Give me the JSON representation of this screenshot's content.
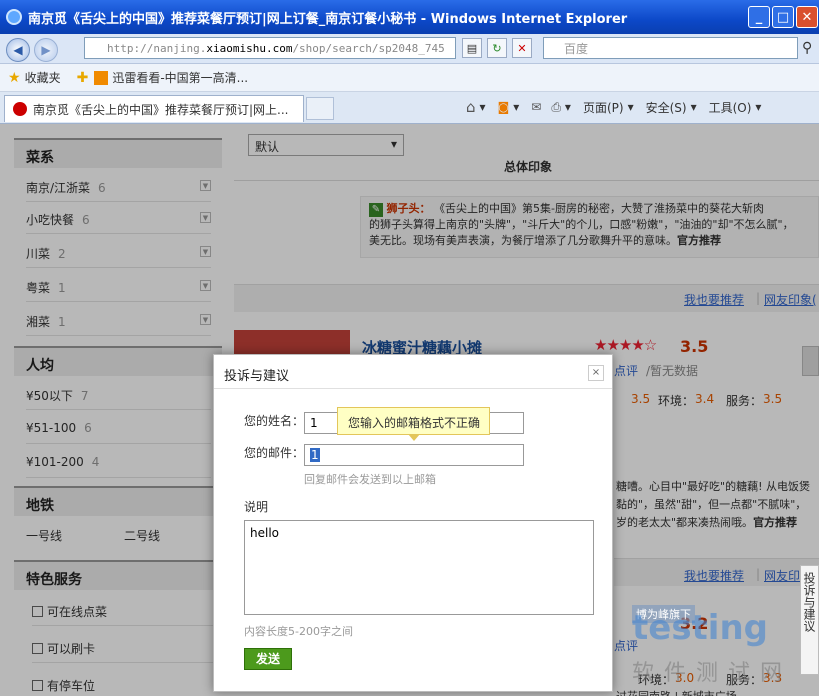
{
  "browser": {
    "window_title": "南京觅《舌尖上的中国》推荐菜餐厅预订|网上订餐_南京订餐小秘书 - Windows Internet Explorer",
    "url_host": "http://nanjing.",
    "url_domain": "xiaomishu.com",
    "url_path": "/shop/search/sp2048_745",
    "search_placeholder": "百度",
    "favorites_label": "收藏夹",
    "fav_link": "迅雷看看-中国第一高清...",
    "tab_title": "南京觅《舌尖上的中国》推荐菜餐厅预订|网上...",
    "cmd_page": "页面(P)",
    "cmd_safety": "安全(S)",
    "cmd_tools": "工具(O)",
    "buttons": {
      "min": "_",
      "max": "□",
      "close": "✕",
      "back": "◀",
      "fwd": "▶",
      "refresh": "↻",
      "stop": "✕",
      "go": "→"
    }
  },
  "sidebar": {
    "cuisine_title": "菜系",
    "cuisine": [
      {
        "label": "南京/江浙菜",
        "count": "6"
      },
      {
        "label": "小吃快餐",
        "count": "6"
      },
      {
        "label": "川菜",
        "count": "2"
      },
      {
        "label": "粤菜",
        "count": "1"
      },
      {
        "label": "湘菜",
        "count": "1"
      }
    ],
    "price_title": "人均",
    "price": [
      {
        "label": "¥50以下",
        "count": "7"
      },
      {
        "label": "¥51-100",
        "count": "6"
      },
      {
        "label": "¥101-200",
        "count": "4"
      }
    ],
    "metro_title": "地铁",
    "metro": [
      "一号线",
      "二号线"
    ],
    "service_title": "特色服务",
    "services": [
      "可在线点菜",
      "可以刷卡",
      "有停车位"
    ]
  },
  "main": {
    "sort_value": "默认",
    "overall_label": "总体印象",
    "dish_name": "狮子头：",
    "dish_desc1": "《舌尖上的中国》第5集-厨房的秘密，大赞了淮扬菜中的葵花大斩肉",
    "dish_desc2": "的狮子头算得上南京的\"头牌\"，\"斗斤大\"的个儿，口感\"粉嫩\"，\"油油的\"却\"不怎么腻\"，",
    "dish_desc3": "美无比。现场有美声表演，为餐厅增添了几分歌舞升平的意味。",
    "official": "官方推荐",
    "recommend_link": "我也要推荐",
    "impression_link": "网友印象(",
    "restaurant_name": "冰糖蜜汁糖藕小摊",
    "rating": "3.5",
    "stars": "★★★★☆",
    "review_link": "点评",
    "no_data": "/暂无数据",
    "score_first": "3.5",
    "env_label": "环境：",
    "env_score": "3.4",
    "service_label": "服务：",
    "service_score": "3.5",
    "mid_text1": "糖嘈。心目中\"最好吃\"的糖藕! 从电饭煲",
    "mid_text2": "黏的\"，虽然\"甜\"，但一点都\"不腻味\"，",
    "mid_text3": "岁的老太太\"都来凑热闹哦。",
    "official2": "官方推荐",
    "recommend_link2": "我也要推荐",
    "impression_link2": "网友印",
    "rating2": "3.2",
    "review_link2": "点评",
    "env_label2": "环境：",
    "env_score2": "3.0",
    "service_label2": "服务：",
    "service_score2": "3.3",
    "bottom_text": "过花园南路 | 新城市广场"
  },
  "dialog": {
    "title": "投诉与建议",
    "close": "×",
    "name_label": "您的姓名：",
    "name_value": "1",
    "email_label": "您的邮件：",
    "email_value": "1",
    "email_hint": "回复邮件会发送到以上邮箱",
    "tooltip": "您输入的邮箱格式不正确",
    "desc_label": "说明",
    "desc_value": "hello",
    "length_hint": "内容长度5-200字之间",
    "submit": "发送"
  },
  "feedback_tab": "投诉与建议",
  "watermark": {
    "brand": "testing",
    "sub": "软件测试网",
    "tag": "博为峰旗下"
  }
}
